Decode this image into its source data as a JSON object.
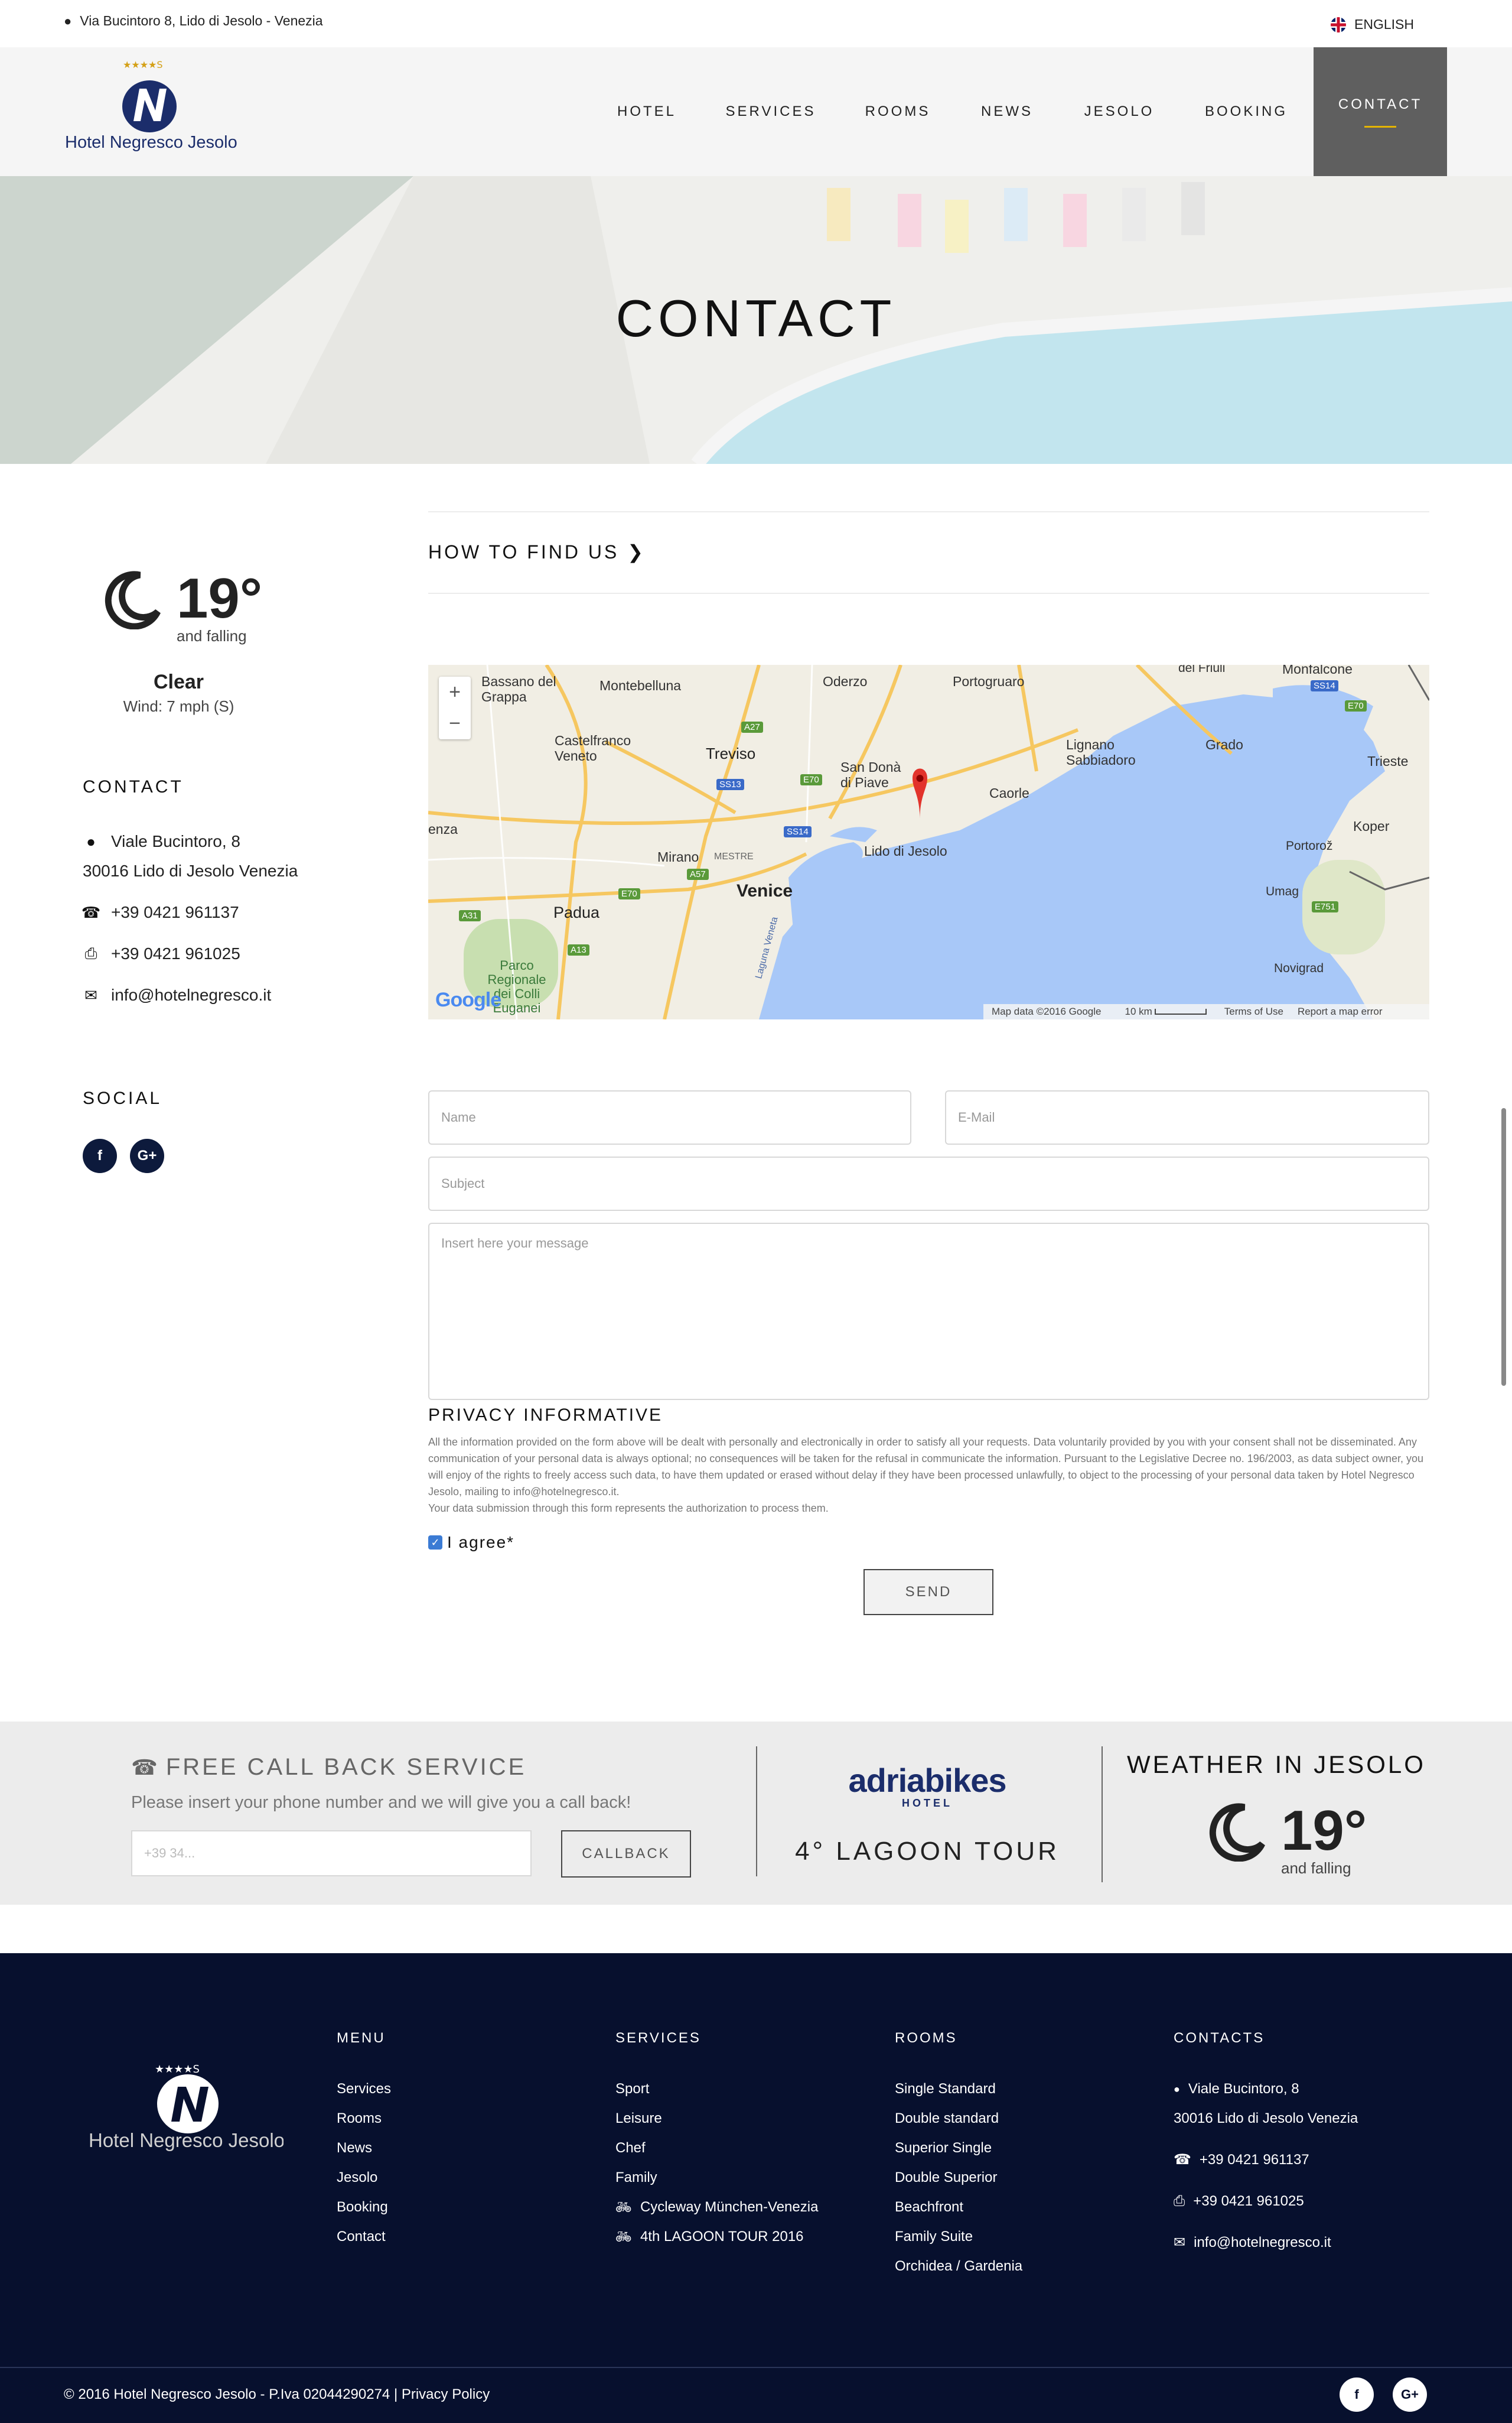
{
  "topbar": {
    "address": "Via Bucintoro 8, Lido di Jesolo - Venezia",
    "language": "ENGLISH"
  },
  "logo": {
    "stars": "★★★★S",
    "name": "Hotel Negresco Jesolo"
  },
  "nav": [
    "HOTEL",
    "SERVICES",
    "ROOMS",
    "NEWS",
    "JESOLO",
    "BOOKING",
    "CONTACT"
  ],
  "hero": {
    "title": "CONTACT"
  },
  "weather": {
    "temp": "19°",
    "trend": "and falling",
    "condition": "Clear",
    "wind": "Wind: 7 mph (S)"
  },
  "contact": {
    "title": "CONTACT",
    "street": "Viale Bucintoro, 8",
    "city": "30016 Lido di Jesolo Venezia",
    "phone": "+39 0421 961137",
    "fax": "+39 0421 961025",
    "email": "info@hotelnegresco.it"
  },
  "social": {
    "title": "SOCIAL",
    "facebook": "f",
    "google": "G+"
  },
  "find_us": "HOW TO FIND US",
  "map": {
    "zoom_in": "+",
    "zoom_out": "−",
    "labels": [
      "Bassano del Grappa",
      "Montebelluna",
      "Oderzo",
      "Portogruaro",
      "Monfalcone",
      "Castelfranco Veneto",
      "Treviso",
      "San Donà di Piave",
      "Lignano Sabbiadoro",
      "Grado",
      "Trieste",
      "Caorle",
      "Lido di Jesolo",
      "Koper",
      "Portorož",
      "Mirano",
      "MESTRE",
      "Venice",
      "Padua",
      "Umag",
      "Novigrad",
      "Parco Regionale dei Colli Euganei",
      "Laguna Veneta",
      "enza",
      "del Friuli"
    ],
    "roads": [
      "A27",
      "E70",
      "SS13",
      "SS14",
      "A57",
      "E70",
      "A31",
      "A13",
      "E751",
      "SS14",
      "E70"
    ],
    "footer": [
      "Map data ©2016 Google",
      "10 km",
      "Terms of Use",
      "Report a map error"
    ],
    "google": "Google"
  },
  "form": {
    "name_placeholder": "Name",
    "email_placeholder": "E-Mail",
    "subject_placeholder": "Subject",
    "message_placeholder": "Insert here your message",
    "privacy_title": "PRIVACY INFORMATIVE",
    "privacy_text": "All the information provided on the form above will be dealt with personally and electronically in order to satisfy all your requests. Data voluntarily provided by you with your consent shall not be disseminated. Any communication of your personal data is always optional; no consequences will be taken for the refusal in communicate the information. Pursuant to the Legislative Decree no. 196/2003, as data subject owner, you will enjoy of the rights to freely access such data, to have them updated or erased without delay if they have been processed unlawfully, to object to the processing of your personal data taken by Hotel Negresco Jesolo, mailing to info@hotelnegresco.it.",
    "privacy_text2": "Your data submission through this form represents the authorization to process them.",
    "agree": "I agree*",
    "send": "SEND"
  },
  "callback": {
    "title": "FREE CALL BACK SERVICE",
    "subtitle": "Please insert your phone number and we will give you a call back!",
    "placeholder": "+39 34...",
    "button": "CALLBACK"
  },
  "adriabikes": {
    "brand": "adriabikes",
    "sub": "HOTEL",
    "tour": "4° LAGOON TOUR"
  },
  "weather_jesolo": {
    "title": "WEATHER IN JESOLO",
    "temp": "19°",
    "trend": "and falling"
  },
  "footer": {
    "menu_title": "MENU",
    "menu": [
      "Services",
      "Rooms",
      "News",
      "Jesolo",
      "Booking",
      "Contact"
    ],
    "services_title": "SERVICES",
    "services": [
      "Sport",
      "Leisure",
      "Chef",
      "Family",
      "Cycleway München-Venezia",
      "4th LAGOON TOUR 2016"
    ],
    "rooms_title": "ROOMS",
    "rooms": [
      "Single Standard",
      "Double standard",
      "Superior Single",
      "Double Superior",
      "Beachfront",
      "Family Suite",
      "Orchidea / Gardenia"
    ],
    "contacts_title": "CONTACTS",
    "street": "Viale Bucintoro, 8",
    "city": "30016 Lido di Jesolo Venezia",
    "phone": "+39 0421 961137",
    "fax": "+39 0421 961025",
    "email": "info@hotelnegresco.it",
    "copyright": "© 2016 Hotel Negresco Jesolo - P.Iva 02044290274 | Privacy Policy",
    "facebook": "f",
    "google": "G+"
  },
  "colors": {
    "navy": "#07102e",
    "nav_active": "#5f5f5f",
    "accent": "#e4b400",
    "map_water": "#a8c8f8"
  }
}
